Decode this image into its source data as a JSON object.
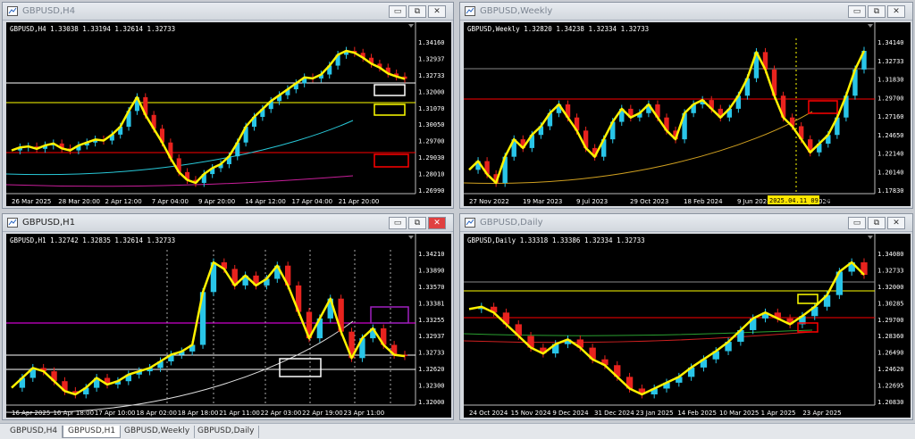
{
  "windows": [
    {
      "title": "GBPUSD,H4",
      "info": "GBPUSD,H4  1.33038 1.33194 1.32614 1.32733",
      "prices": [
        "1.34160",
        "1.32937",
        "1.32733",
        "1.32000",
        "1.31070",
        "1.30050",
        "1.29700",
        "1.29030",
        "1.28010",
        "1.26990"
      ],
      "dates": [
        "26 Mar 2025",
        "28 Mar 20:00",
        "2 Apr 12:00",
        "7 Apr 04:00",
        "9 Apr 20:00",
        "14 Apr 12:00",
        "17 Apr 04:00",
        "21 Apr 20:00"
      ],
      "series": [
        1.291,
        1.2925,
        1.293,
        1.2918,
        1.2935,
        1.2945,
        1.292,
        1.291,
        1.2935,
        1.295,
        1.2965,
        1.296,
        1.299,
        1.303,
        1.311,
        1.318,
        1.309,
        1.302,
        1.295,
        1.287,
        1.28,
        1.276,
        1.2745,
        1.279,
        1.282,
        1.284,
        1.288,
        1.295,
        1.303,
        1.308,
        1.312,
        1.316,
        1.319,
        1.322,
        1.325,
        1.328,
        1.3275,
        1.3295,
        1.334,
        1.3395,
        1.3415,
        1.3405,
        1.338,
        1.335,
        1.333,
        1.33,
        1.3285,
        1.3273
      ]
    },
    {
      "title": "GBPUSD,Weekly",
      "info": "GBPUSD,Weekly  1.32820 1.34238 1.32334 1.32733",
      "prices": [
        "1.34140",
        "1.32733",
        "1.31830",
        "1.29700",
        "1.27160",
        "1.24650",
        "1.22140",
        "1.20140",
        "1.17830"
      ],
      "dates": [
        "27 Nov 2022",
        "19 Mar 2023",
        "9 Jul 2023",
        "29 Oct 2023",
        "18 Feb 2024",
        "9 Jun 2024",
        "29 Sep 2024"
      ],
      "cursor": "2025.04.11 09:30",
      "series": [
        1.205,
        1.215,
        1.2,
        1.19,
        1.22,
        1.24,
        1.23,
        1.245,
        1.255,
        1.27,
        1.28,
        1.265,
        1.25,
        1.23,
        1.22,
        1.24,
        1.26,
        1.275,
        1.265,
        1.27,
        1.28,
        1.265,
        1.25,
        1.24,
        1.27,
        1.28,
        1.285,
        1.275,
        1.265,
        1.275,
        1.29,
        1.31,
        1.34,
        1.32,
        1.29,
        1.265,
        1.255,
        1.24,
        1.225,
        1.235,
        1.245,
        1.265,
        1.29,
        1.32,
        1.3414
      ]
    },
    {
      "title": "GBPUSD,H1",
      "info": "GBPUSD,H1  1.32742 1.32835 1.32614 1.32733",
      "prices": [
        "1.34210",
        "1.33890",
        "1.33570",
        "1.33381",
        "1.33255",
        "1.32937",
        "1.32733",
        "1.32620",
        "1.32300",
        "1.32000"
      ],
      "dates": [
        "16 Apr 2025",
        "16 Apr 18:00",
        "17 Apr 10:00",
        "18 Apr 02:00",
        "18 Apr 18:00",
        "21 Apr 11:00",
        "22 Apr 03:00",
        "22 Apr 19:00",
        "23 Apr 11:00"
      ],
      "series": [
        1.3225,
        1.324,
        1.3255,
        1.325,
        1.3235,
        1.322,
        1.3215,
        1.3225,
        1.324,
        1.323,
        1.3235,
        1.3245,
        1.325,
        1.3255,
        1.3265,
        1.3275,
        1.328,
        1.329,
        1.337,
        1.3415,
        1.3405,
        1.338,
        1.3395,
        1.338,
        1.339,
        1.341,
        1.338,
        1.334,
        1.33,
        1.333,
        1.336,
        1.331,
        1.327,
        1.33,
        1.3315,
        1.329,
        1.3275,
        1.3273
      ]
    },
    {
      "title": "GBPUSD,Daily",
      "info": "GBPUSD,Daily  1.33318 1.33386 1.32334 1.32733",
      "prices": [
        "1.34080",
        "1.32733",
        "1.32000",
        "1.30285",
        "1.29700",
        "1.28360",
        "1.26490",
        "1.24620",
        "1.22695",
        "1.20830"
      ],
      "dates": [
        "24 Oct 2024",
        "15 Nov 2024",
        "9 Dec 2024",
        "31 Dec 2024",
        "23 Jan 2025",
        "14 Feb 2025",
        "10 Mar 2025",
        "1 Apr 2025",
        "23 Apr 2025"
      ],
      "series": [
        1.298,
        1.3,
        1.295,
        1.285,
        1.275,
        1.265,
        1.26,
        1.268,
        1.272,
        1.265,
        1.255,
        1.25,
        1.24,
        1.23,
        1.225,
        1.23,
        1.235,
        1.24,
        1.248,
        1.255,
        1.262,
        1.27,
        1.28,
        1.29,
        1.295,
        1.29,
        1.285,
        1.292,
        1.3,
        1.31,
        1.33,
        1.338,
        1.3273
      ]
    }
  ],
  "tabs": [
    "GBPUSD,H4",
    "GBPUSD,H1",
    "GBPUSD,Weekly",
    "GBPUSD,Daily"
  ],
  "active_tab": "GBPUSD,H1",
  "colors": {
    "up": "#29c5e8",
    "down": "#e8231e",
    "trend": "#fff200",
    "grid": "#6e6e6e"
  }
}
